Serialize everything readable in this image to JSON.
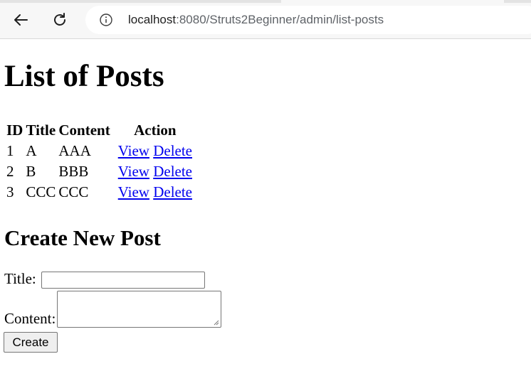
{
  "browser": {
    "url_host": "localhost",
    "url_path": ":8080/Struts2Beginner/admin/list-posts"
  },
  "page": {
    "heading": "List of Posts",
    "table": {
      "headers": [
        "ID",
        "Title",
        "Content",
        "Action"
      ],
      "rows": [
        {
          "id": "1",
          "title": "A",
          "content": "AAA",
          "view": "View",
          "delete": "Delete"
        },
        {
          "id": "2",
          "title": "B",
          "content": "BBB",
          "view": "View",
          "delete": "Delete"
        },
        {
          "id": "3",
          "title": "CCC",
          "content": "CCC",
          "view": "View",
          "delete": "Delete"
        }
      ]
    },
    "form": {
      "heading": "Create New Post",
      "title_label": "Title:",
      "title_value": "",
      "content_label": "Content:",
      "content_value": "",
      "submit_label": "Create"
    }
  }
}
